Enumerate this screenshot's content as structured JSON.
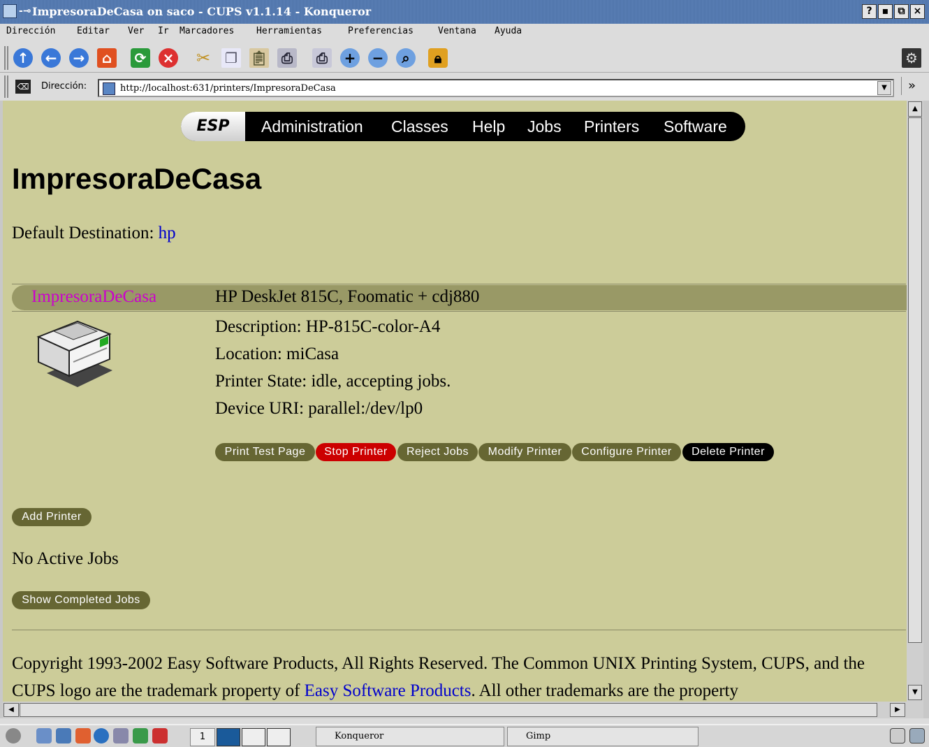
{
  "window": {
    "title": "ImpresoraDeCasa on saco - CUPS v1.1.14 - Konqueror",
    "buttons": [
      "?",
      "▪",
      "⧉",
      "×"
    ]
  },
  "menubar": [
    "Dirección",
    "Editar",
    "Ver",
    "Ir",
    "Marcadores",
    "Herramientas",
    "Preferencias",
    "Ventana",
    "Ayuda"
  ],
  "addressbar": {
    "label": "Dirección:",
    "url": "http://localhost:631/printers/ImpresoraDeCasa",
    "overflow": "»"
  },
  "cups": {
    "nav": {
      "logo": "ESP",
      "items": [
        "Administration",
        "Classes",
        "Help",
        "Jobs",
        "Printers",
        "Software"
      ]
    },
    "title": "ImpresoraDeCasa",
    "default_dest": {
      "label": "Default Destination:",
      "value": "hp"
    },
    "printer": {
      "name": "ImpresoraDeCasa",
      "model": "HP DeskJet 815C, Foomatic + cdj880",
      "description": "Description: HP-815C-color-A4",
      "location": "Location: miCasa",
      "state": "Printer State: idle, accepting jobs.",
      "uri": "Device URI: parallel:/dev/lp0"
    },
    "actions": [
      "Print Test Page",
      "Stop Printer",
      "Reject Jobs",
      "Modify Printer",
      "Configure Printer",
      "Delete Printer"
    ],
    "add_printer": "Add Printer",
    "no_jobs": "No Active Jobs",
    "show_completed": "Show Completed Jobs",
    "copyright": {
      "pre": "Copyright 1993-2002 Easy Software Products, All Rights Reserved. The Common UNIX Printing System, CUPS, and the CUPS logo are the trademark property of ",
      "link": "Easy Software Products",
      "post": ". All other trademarks are the property"
    }
  },
  "taskbar": {
    "desktop": "1",
    "tasks": [
      "Konqueror",
      "Gimp"
    ]
  },
  "colors": {
    "page_bg": "#cccc99",
    "bar": "#999966",
    "button_olive": "#666633",
    "button_red": "#cc0000",
    "link": "#0000cc",
    "printer_name": "#cc00cc"
  }
}
